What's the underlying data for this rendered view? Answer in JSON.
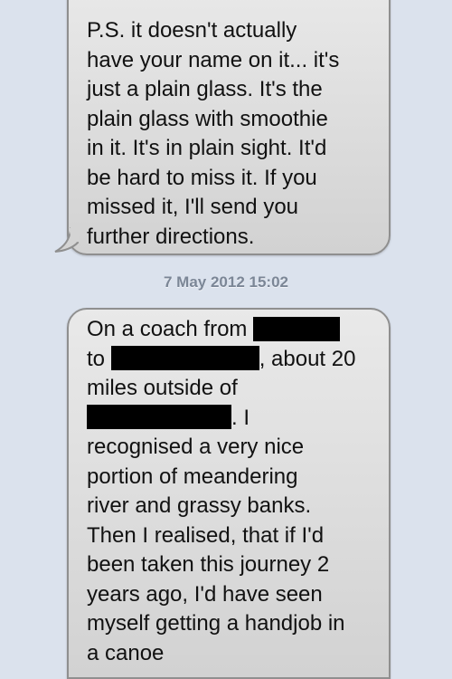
{
  "messages": [
    {
      "lines": [
        "P.S. it doesn't actually",
        "have your name on it... it's",
        "just a plain glass. It's the",
        "plain glass with smoothie",
        "in it. It's in plain sight. It'd",
        "be hard to miss it. If you",
        "missed it, I'll send you",
        "further directions."
      ]
    },
    {
      "timestamp": "7 May 2012 15:02",
      "line1": "On a coach from",
      "line2_start": "to",
      "line2_end": ", about 20",
      "line3": "miles outside of",
      "line4_end": ". I",
      "lines_rest": [
        "recognised a very nice",
        "portion of meandering",
        "river and grassy banks.",
        "Then I realised, that if I'd",
        "been taken this journey 2",
        "years ago, I'd have seen",
        "myself getting a handjob in",
        "a canoe"
      ]
    }
  ],
  "colors": {
    "background": "#dbe2ed",
    "bubble": "#dcdcdc",
    "bubble_border": "#8f8f8f",
    "timestamp": "#7b8696",
    "redaction": "#000000"
  }
}
